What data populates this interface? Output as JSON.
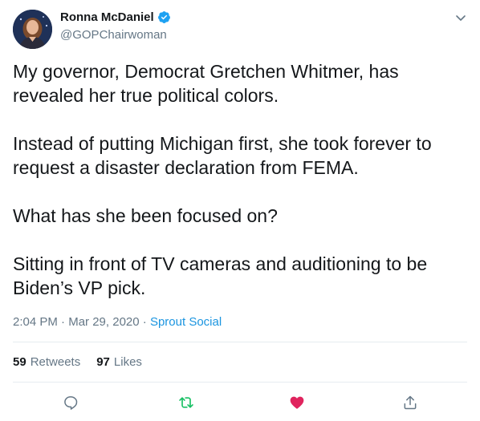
{
  "author": {
    "name": "Ronna McDaniel",
    "handle": "@GOPChairwoman"
  },
  "tweet": {
    "paragraphs": [
      "My governor, Democrat Gretchen Whitmer, has revealed her true political colors.",
      "Instead of putting Michigan first, she took forever to request a disaster declaration from FEMA.",
      "What has she been focused on?",
      "Sitting in front of TV cameras and auditioning to be Biden’s VP pick."
    ]
  },
  "meta": {
    "time": "2:04 PM",
    "separator1": "·",
    "date": "Mar 29, 2020",
    "separator2": "·",
    "source": "Sprout Social"
  },
  "stats": {
    "retweets_count": "59",
    "retweets_label": "Retweets",
    "likes_count": "97",
    "likes_label": "Likes"
  },
  "icons": {
    "verified": "verified-badge-icon",
    "caret": "chevron-down-icon",
    "reply": "reply-icon",
    "retweet": "retweet-icon",
    "like": "heart-icon",
    "share": "share-icon"
  },
  "colors": {
    "verified": "#1da1f2",
    "retweet": "#17bf63",
    "like": "#e0245e",
    "muted": "#657786",
    "link": "#1b95e0"
  }
}
